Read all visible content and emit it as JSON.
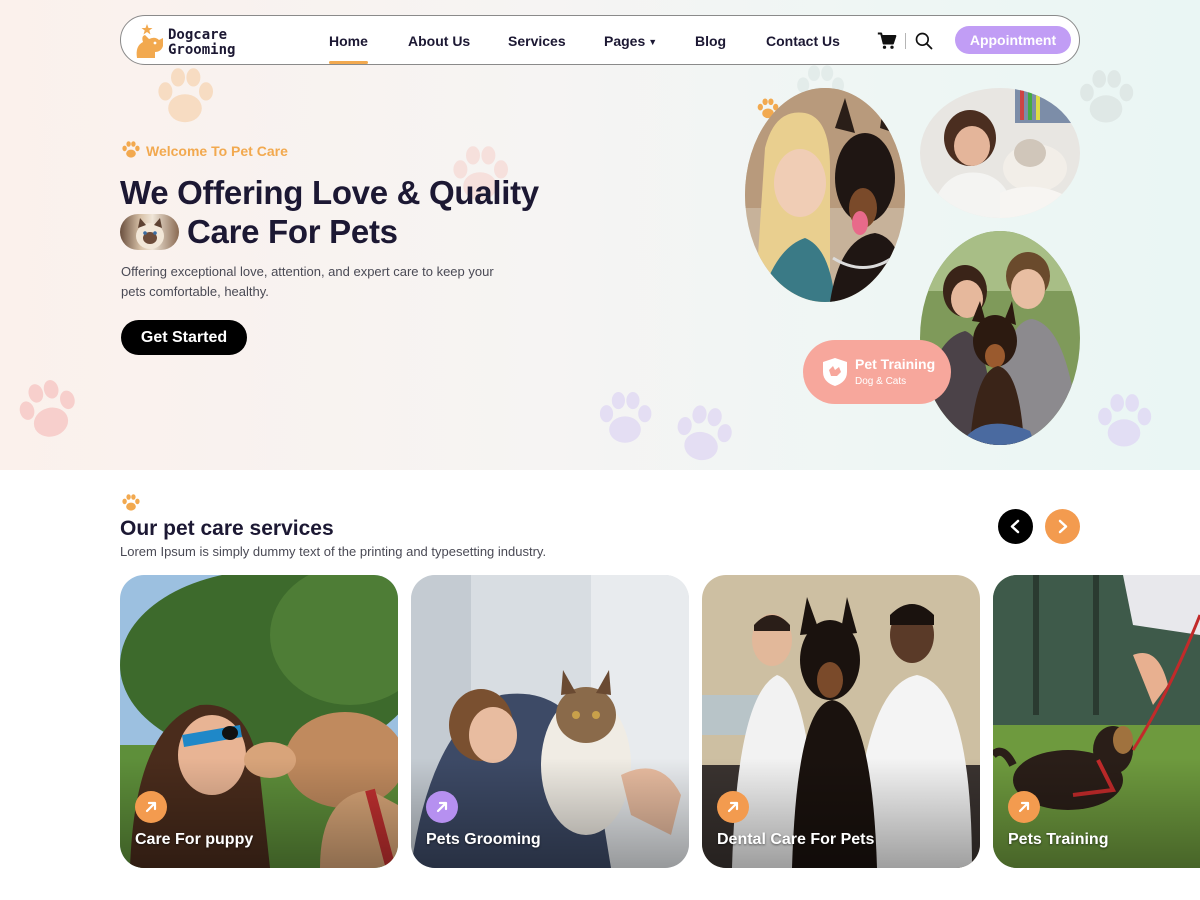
{
  "brand": {
    "line1": "Dogcare",
    "line2": "Grooming"
  },
  "nav": {
    "items": [
      {
        "label": "Home",
        "active": true
      },
      {
        "label": "About Us"
      },
      {
        "label": "Services"
      },
      {
        "label": "Pages",
        "has_dropdown": true
      },
      {
        "label": "Blog"
      },
      {
        "label": "Contact Us"
      }
    ],
    "cart_icon": "cart-icon",
    "search_icon": "search-icon",
    "appointment_label": "Appointment"
  },
  "hero": {
    "eyebrow": "Welcome To Pet Care",
    "headline_line1": "We Offering Love & Quality",
    "headline_line2": "Care For Pets",
    "description": "Offering exceptional love, attention, and expert care to keep your pets comfortable, healthy.",
    "cta_label": "Get Started",
    "badge": {
      "title": "Pet Training",
      "subtitle": "Dog & Cats"
    }
  },
  "services": {
    "title": "Our pet care services",
    "subtitle": "Lorem Ipsum is simply dummy text of the printing and typesetting industry.",
    "cards": [
      {
        "label": "Care For puppy",
        "arrow_color": "#f39b4f"
      },
      {
        "label": "Pets Grooming",
        "arrow_color": "#b690f0"
      },
      {
        "label": "Dental Care For Pets",
        "arrow_color": "#f39b4f"
      },
      {
        "label": "Pets Training",
        "arrow_color": "#f39b4f"
      }
    ]
  },
  "colors": {
    "accent_orange": "#f2a94f",
    "accent_purple": "#c19df5",
    "badge_pink": "#f7a79c",
    "heading": "#1c1833"
  }
}
